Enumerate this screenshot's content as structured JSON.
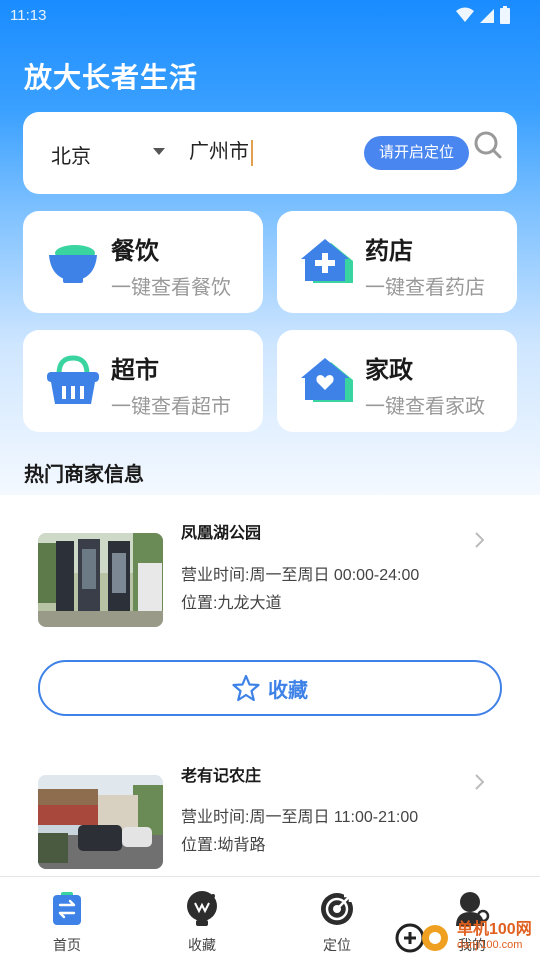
{
  "status_bar": {
    "time": "11:13"
  },
  "app": {
    "title": "放大长者生活"
  },
  "search": {
    "city": "北京",
    "input_value": "广州市",
    "locate_label": "请开启定位"
  },
  "categories": [
    {
      "title": "餐饮",
      "subtitle": "一键查看餐饮",
      "icon": "bowl-icon"
    },
    {
      "title": "药店",
      "subtitle": "一键查看药店",
      "icon": "pharmacy-icon"
    },
    {
      "title": "超市",
      "subtitle": "一键查看超市",
      "icon": "basket-icon"
    },
    {
      "title": "家政",
      "subtitle": "一键查看家政",
      "icon": "housekeeping-icon"
    }
  ],
  "section": {
    "title": "热门商家信息"
  },
  "listings": [
    {
      "name": "凤凰湖公园",
      "hours": "营业时间:周一至周日 00:00-24:00",
      "address": "位置:九龙大道"
    },
    {
      "name": "老有记农庄",
      "hours": "营业时间:周一至周日 11:00-21:00",
      "address": "位置:坳背路"
    }
  ],
  "favorite_button": {
    "label": "收藏"
  },
  "bottom_nav": [
    {
      "label": "首页",
      "icon": "home-icon"
    },
    {
      "label": "收藏",
      "icon": "favorites-icon"
    },
    {
      "label": "定位",
      "icon": "target-icon"
    },
    {
      "label": "我的",
      "icon": "profile-icon"
    }
  ],
  "watermark": {
    "brand": "单机100网",
    "url": "danji100.com"
  },
  "colors": {
    "primary": "#3e82e8",
    "header_blue": "#1a8cff",
    "accent_green": "#3ad4a0"
  }
}
